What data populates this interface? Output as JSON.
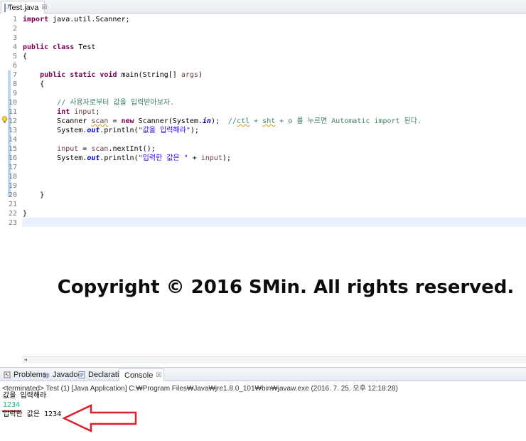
{
  "editor_tab": {
    "filename": "Test.java",
    "close_glyph": "☒"
  },
  "code_lines": [
    {
      "n": "1"
    },
    {
      "n": "2"
    },
    {
      "n": "3"
    },
    {
      "n": "4"
    },
    {
      "n": "5"
    },
    {
      "n": "6"
    },
    {
      "n": "7"
    },
    {
      "n": "8"
    },
    {
      "n": "9"
    },
    {
      "n": "10"
    },
    {
      "n": "11"
    },
    {
      "n": "12"
    },
    {
      "n": "13"
    },
    {
      "n": "14"
    },
    {
      "n": "15"
    },
    {
      "n": "16"
    },
    {
      "n": "17"
    },
    {
      "n": "18"
    },
    {
      "n": "19"
    },
    {
      "n": "20"
    },
    {
      "n": "21"
    },
    {
      "n": "22"
    },
    {
      "n": "23"
    }
  ],
  "code": {
    "l1_kw": "import",
    "l1_rest": " java.util.Scanner;",
    "l4_kw1": "public",
    "l4_kw2": "class",
    "l4_rest": " Test",
    "l5": "{",
    "l7_kw1": "public",
    "l7_kw2": "static",
    "l7_kw3": "void",
    "l7_mid": " main(String[] ",
    "l7_arg": "args",
    "l7_end": ")",
    "l8": "{",
    "l10_comment": "// 사용자로부터 값을 입력받아보자.",
    "l11_kw": "int",
    "l11_var": "input",
    "l11_end": ";",
    "l12_a": "Scanner ",
    "l12_var": "scan",
    "l12_b": " = ",
    "l12_kw": "new",
    "l12_c": " Scanner(System.",
    "l12_fld": "in",
    "l12_d": ");  ",
    "l12_cm_a": "//",
    "l12_cm_ctl": "ctl",
    "l12_cm_b": " + ",
    "l12_cm_sht": "sht",
    "l12_cm_c": " + o 를 누르면 Automatic import 된다.",
    "l13_a": "System.",
    "l13_fld": "out",
    "l13_b": ".println(",
    "l13_str": "\"값을 입력해라\"",
    "l13_c": ");",
    "l15_var": "input",
    "l15_a": " = ",
    "l15_var2": "scan",
    "l15_b": ".nextInt();",
    "l16_a": "System.",
    "l16_fld": "out",
    "l16_b": ".println(",
    "l16_str": "\"입력한 값은 \"",
    "l16_c": " + ",
    "l16_var": "input",
    "l16_d": ");",
    "l20": "}",
    "l22": "}"
  },
  "watermark": "Copyright © 2016 SMin. All rights reserved.",
  "views_tabs": {
    "problems": "Problems",
    "javadoc": "Javadoc",
    "declaration": "Declaration",
    "console": "Console",
    "close_glyph": "☒"
  },
  "console": {
    "header": "<terminated> Test (1) [Java Application] C:₩Program Files₩Java₩jre1.8.0_101₩bin₩javaw.exe (2016. 7. 25. 오후 12:18:28)",
    "output_line1": "값을 입력해라",
    "input_line": "1234",
    "output_line2": "입력한 값은 1234"
  },
  "colors": {
    "keyword": "#7f0055",
    "comment": "#3f7f5f",
    "string": "#2a00ff",
    "field": "#0000c0",
    "console_input": "#00c87d",
    "annotation_arrow": "#e21d2a"
  }
}
